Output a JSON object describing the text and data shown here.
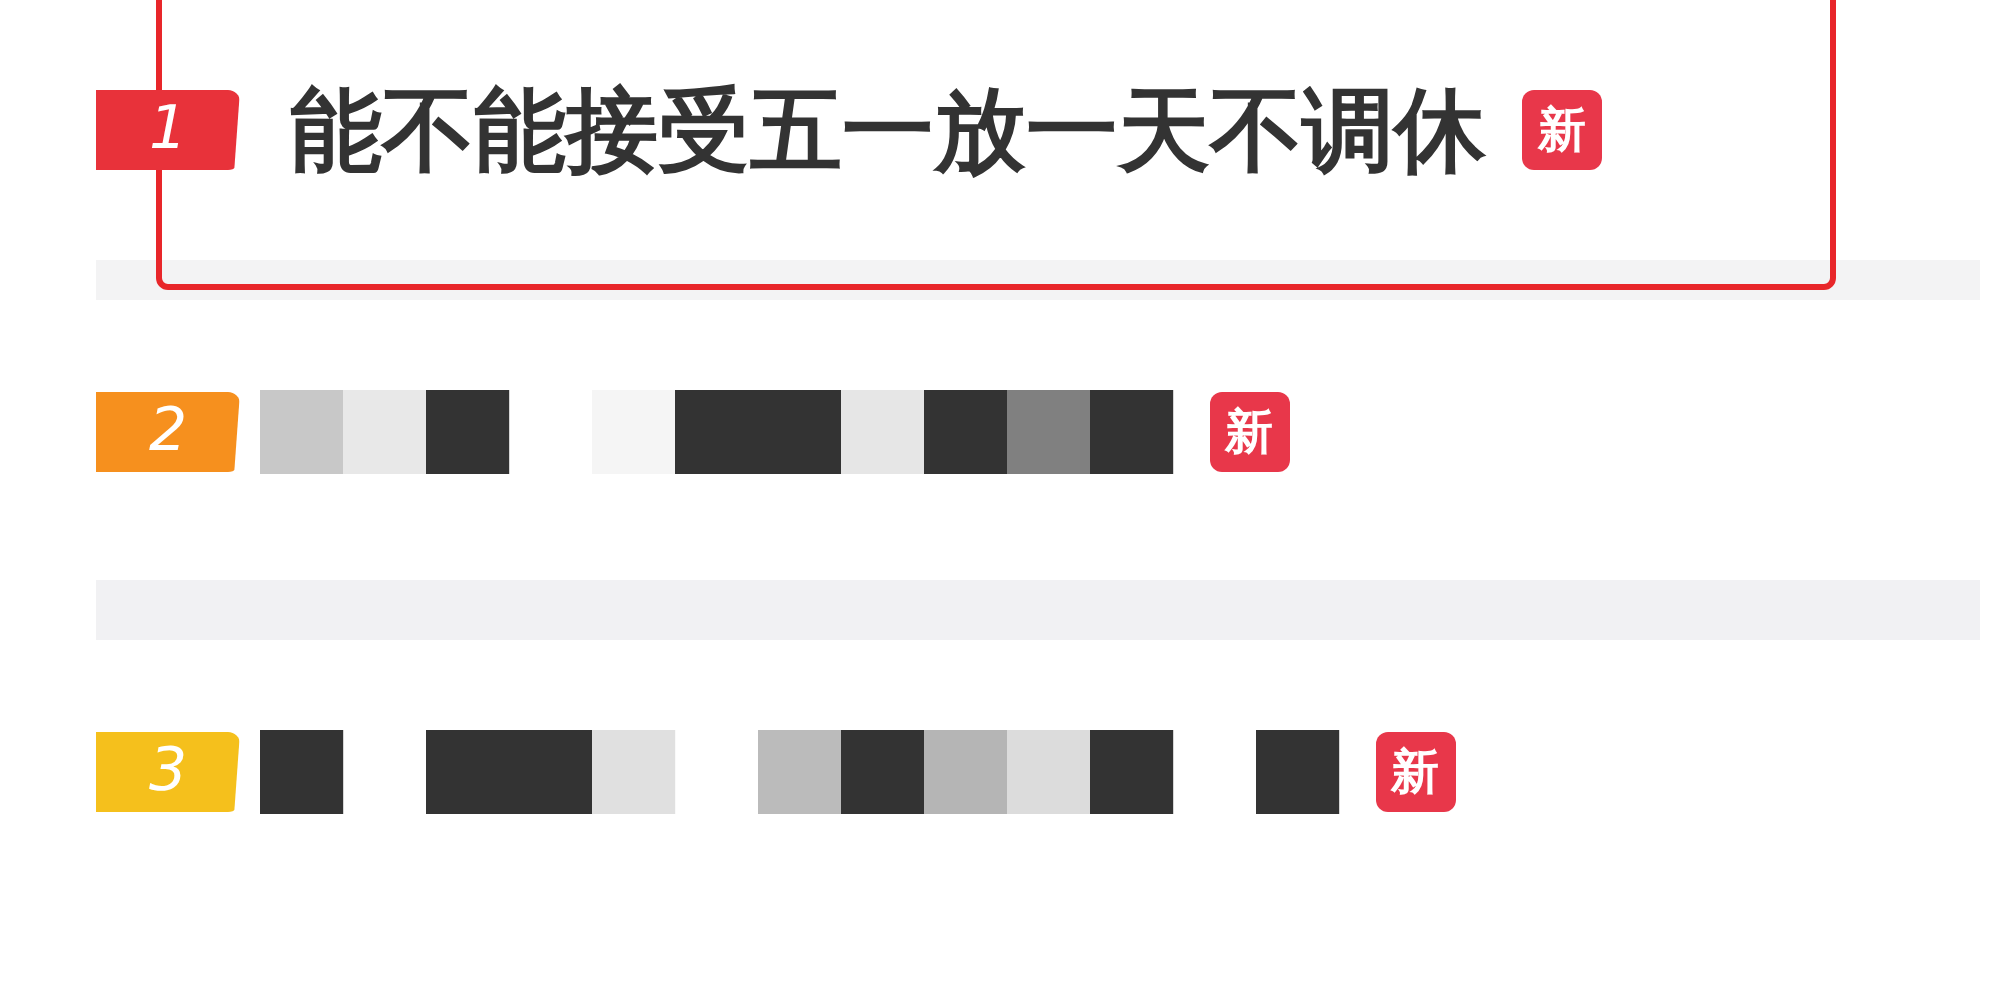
{
  "trending": [
    {
      "rank": "1",
      "color": "#e8323a",
      "kind": "text",
      "title": "能不能接受五一放一天不调休",
      "tag": "新",
      "highlighted": true
    },
    {
      "rank": "2",
      "color": "#f6901e",
      "kind": "redacted",
      "tag": "新",
      "highlighted": false
    },
    {
      "rank": "3",
      "color": "#f5c01c",
      "kind": "redacted",
      "tag": "新",
      "highlighted": false
    }
  ]
}
